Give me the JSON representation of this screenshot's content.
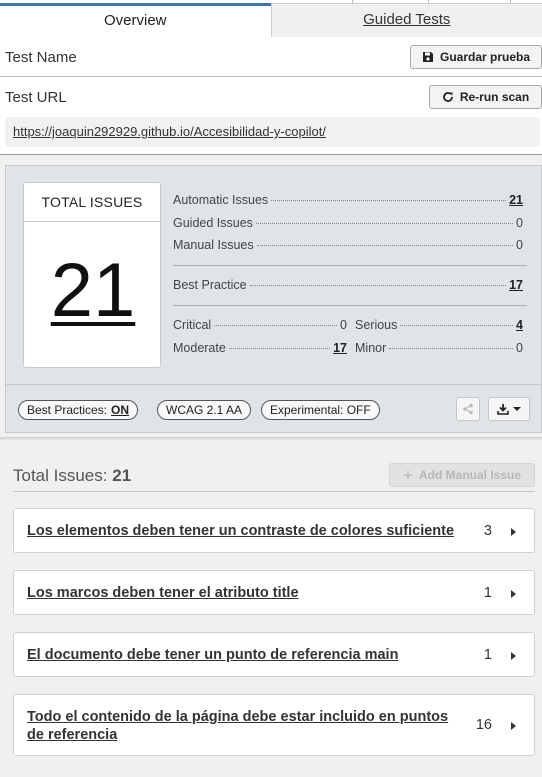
{
  "tabs": [
    {
      "label": "Overview",
      "active": true
    },
    {
      "label": "Guided Tests",
      "active": false
    }
  ],
  "form": {
    "test_name_label": "Test Name",
    "save_button": "Guardar prueba",
    "test_url_label": "Test URL",
    "rerun_button": "Re-run scan",
    "url": "https://joaquin292929.github.io/Accesibilidad-y-copilot/"
  },
  "summary": {
    "total_title": "TOTAL ISSUES",
    "total_value": "21",
    "automatic_label": "Automatic Issues",
    "automatic_value": "21",
    "guided_label": "Guided Issues",
    "guided_value": "0",
    "manual_label": "Manual Issues",
    "manual_value": "0",
    "best_practice_label": "Best Practice",
    "best_practice_value": "17",
    "critical_label": "Critical",
    "critical_value": "0",
    "serious_label": "Serious",
    "serious_value": "4",
    "moderate_label": "Moderate",
    "moderate_value": "17",
    "minor_label": "Minor",
    "minor_value": "0"
  },
  "filters": {
    "best_practices_label": "Best Practices:",
    "best_practices_state": "ON",
    "wcag_label": "WCAG 2.1 AA",
    "experimental_label": "Experimental: OFF"
  },
  "issues_header": {
    "label": "Total Issues:",
    "count": "21",
    "add_button": "Add Manual Issue"
  },
  "issues": [
    {
      "name": "Los elementos deben tener un contraste de colores suficiente",
      "count": "3"
    },
    {
      "name": "Los marcos deben tener el atributo title",
      "count": "1"
    },
    {
      "name": "El documento debe tener un punto de referencia main",
      "count": "1"
    },
    {
      "name": "Todo el contenido de la página debe estar incluido en puntos de referencia",
      "count": "16"
    }
  ],
  "colors": {
    "accent": "#3d77aa",
    "panel": "#dfe4e8",
    "background": "#f0f0f0"
  },
  "icons": [
    "save-icon",
    "refresh-icon",
    "share-icon",
    "download-icon",
    "chevron-down-icon",
    "plus-icon",
    "chevron-right-icon"
  ]
}
